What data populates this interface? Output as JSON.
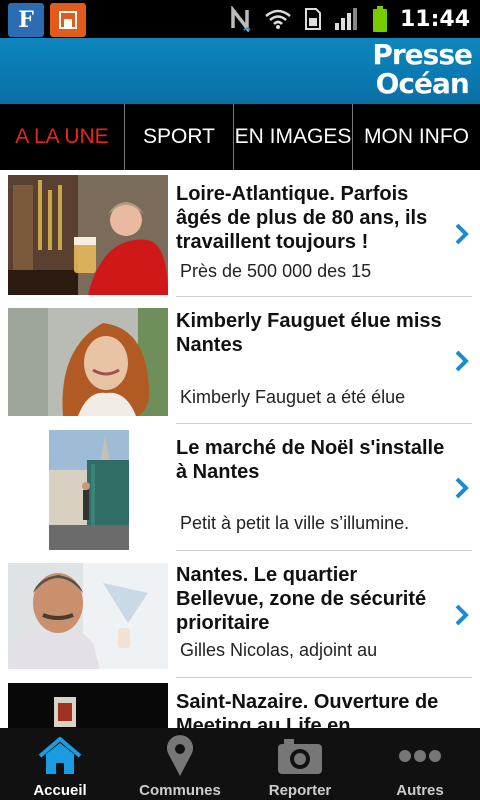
{
  "status_bar": {
    "time": "11:44",
    "icons": [
      "figaro-app-icon",
      "sd-card-icon",
      "nfc-icon",
      "wifi-icon",
      "sim-icon",
      "signal-icon",
      "battery-icon"
    ]
  },
  "header": {
    "logo_line1": "Presse",
    "logo_line2": "Océan",
    "brand_color": "#0a7cb6"
  },
  "tabs": [
    {
      "label": "A LA UNE",
      "active": true
    },
    {
      "label": "SPORT",
      "active": false
    },
    {
      "label": "EN IMAGES",
      "active": false
    },
    {
      "label": "MON INFO",
      "active": false
    }
  ],
  "articles": [
    {
      "title": "Loire-Atlantique. Parfois âgés de plus de 80 ans, ils travaillent toujours !",
      "snippet": "Près de 500 000 des 15"
    },
    {
      "title": "Kimberly Fauguet élue miss Nantes",
      "snippet": "Kimberly Fauguet a été élue"
    },
    {
      "title": "Le marché de Noël s'installe à Nantes",
      "snippet": "Petit à petit la ville s’illumine."
    },
    {
      "title": "Nantes. Le quartier Bellevue, zone de sécurité prioritaire",
      "snippet": "Gilles Nicolas, adjoint au"
    },
    {
      "title": "Saint-Nazaire. Ouverture de Meeting au Life en",
      "snippet": ""
    }
  ],
  "bottom_nav": [
    {
      "label": "Accueil",
      "icon": "home-icon",
      "active": true
    },
    {
      "label": "Communes",
      "icon": "map-pin-icon",
      "active": false
    },
    {
      "label": "Reporter",
      "icon": "camera-icon",
      "active": false
    },
    {
      "label": "Autres",
      "icon": "more-icon",
      "active": false
    }
  ],
  "colors": {
    "accent_red": "#e8241c",
    "chevron_blue": "#1a8ccc",
    "active_nav_blue": "#1b9be0"
  }
}
